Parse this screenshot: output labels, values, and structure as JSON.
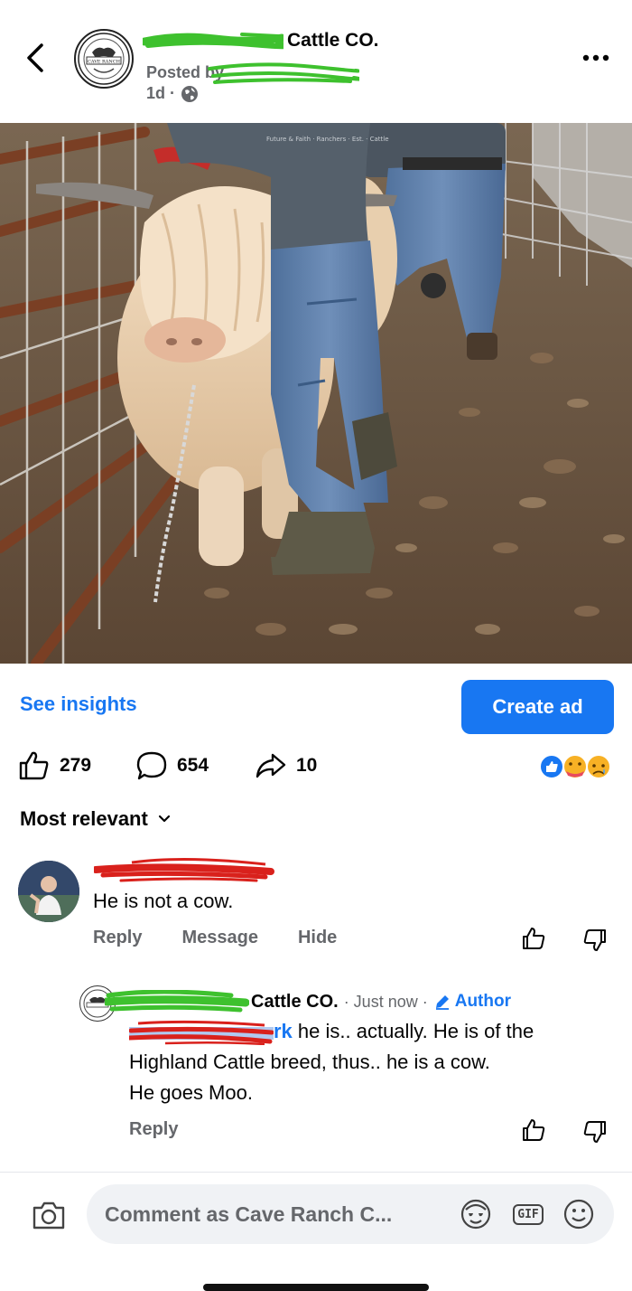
{
  "header": {
    "page_name_suffix": "Cattle CO.",
    "posted_prefix": "Posted by",
    "time": "1d ·",
    "avatar_text": "CAVE RANCH"
  },
  "post": {
    "photo_shirt_text": "Future & Faith · Ranchers · Est. · Cattle"
  },
  "actions": {
    "insights_label": "See insights",
    "create_ad_label": "Create ad"
  },
  "stats": {
    "likes": "279",
    "comments": "654",
    "shares": "10"
  },
  "comments": {
    "sort_label": "Most relevant",
    "items": [
      {
        "text": "He is not a cow.",
        "reply_label": "Reply",
        "message_label": "Message",
        "hide_label": "Hide"
      }
    ],
    "reply": {
      "name_suffix": "Cattle CO.",
      "meta": "· Just now ·",
      "author_label": "Author",
      "tag_suffix": "rk",
      "text_line1": " he is.. actually. He is of the",
      "text_line2": "Highland Cattle breed, thus.. he is a cow.",
      "text_line3": "He goes Moo.",
      "reply_label": "Reply"
    }
  },
  "composer": {
    "placeholder": "Comment as Cave Ranch C...",
    "gif_label": "GIF"
  },
  "colors": {
    "accent": "#1877f2",
    "secondary_text": "#65676b",
    "green_scribble": "#3ec12e",
    "red_scribble": "#d9211c"
  }
}
